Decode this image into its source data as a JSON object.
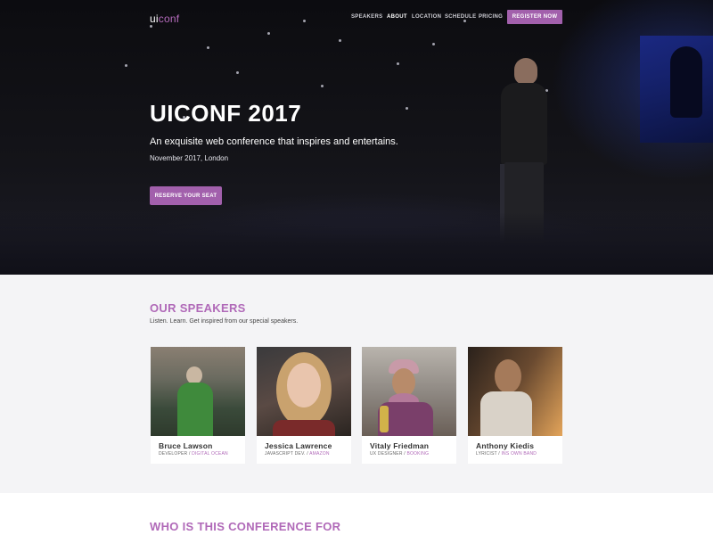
{
  "nav": {
    "logo_ui": "ui",
    "logo_conf": "conf",
    "links": [
      "SPEAKERS",
      "ABOUT",
      "LOCATION",
      "SCHEDULE",
      "PRICING"
    ],
    "active": "ABOUT",
    "register_label": "REGISTER NOW"
  },
  "hero": {
    "title": "UICONF 2017",
    "subtitle": "An exquisite web conference that inspires and entertains.",
    "date_location": "November 2017, London",
    "cta_label": "RESERVE YOUR SEAT"
  },
  "speakers_section": {
    "title": "OUR SPEAKERS",
    "subtitle": "Listen. Learn. Get inspired from our special speakers.",
    "speakers": [
      {
        "name": "Bruce Lawson",
        "role": "DEVELOPER",
        "company": "DIGITAL OCEAN"
      },
      {
        "name": "Jessica Lawrence",
        "role": "JAVASCRIPT DEV.",
        "company": "AMAZON"
      },
      {
        "name": "Vitaly Friedman",
        "role": "UX DESIGNER",
        "company": "BOOKING"
      },
      {
        "name": "Anthony Kiedis",
        "role": "LYRICIST",
        "company": "INS OWN BAND"
      }
    ]
  },
  "audience_section": {
    "title": "WHO IS THIS CONFERENCE FOR"
  },
  "colors": {
    "accent": "#a260ac",
    "heading_accent": "#b069b8",
    "hero_bg": "#0d0d12",
    "page_bg": "#f4f4f6"
  }
}
